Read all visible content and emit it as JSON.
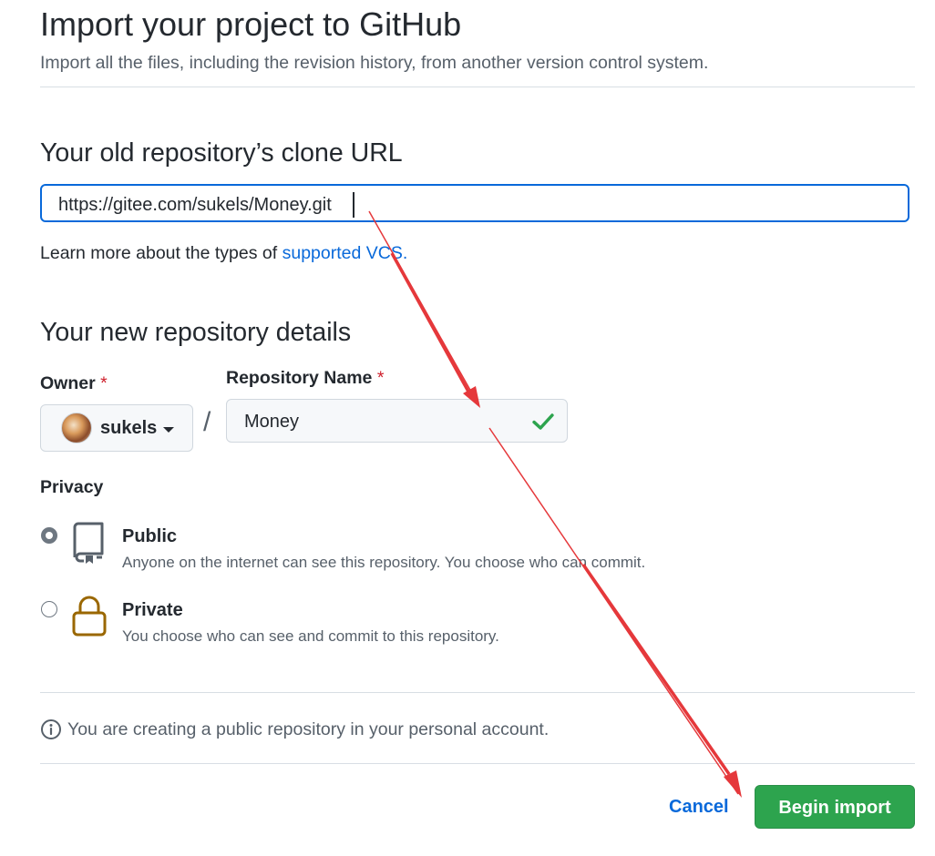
{
  "header": {
    "title": "Import your project to GitHub",
    "subtitle": "Import all the files, including the revision history, from another version control system."
  },
  "clone_section": {
    "heading": "Your old repository’s clone URL",
    "url_value": "https://gitee.com/sukels/Money.git",
    "help_prefix": "Learn more about the types of ",
    "help_link": "supported VCS",
    "help_suffix": "."
  },
  "details_section": {
    "heading": "Your new repository details",
    "owner_label": "Owner",
    "required_mark": "*",
    "owner_value": "sukels",
    "separator": "/",
    "repo_name_label": "Repository Name",
    "repo_name_value": "Money"
  },
  "privacy": {
    "label": "Privacy",
    "options": [
      {
        "title": "Public",
        "description": "Anyone on the internet can see this repository. You choose who can commit.",
        "selected": true
      },
      {
        "title": "Private",
        "description": "You choose who can see and commit to this repository.",
        "selected": false
      }
    ]
  },
  "notice": {
    "text": "You are creating a public repository in your personal account."
  },
  "actions": {
    "cancel_label": "Cancel",
    "begin_label": "Begin import"
  },
  "colors": {
    "accent": "#0969da",
    "primary_button": "#2da44e",
    "check": "#2da44e",
    "private_icon": "#9a6700",
    "annotation_arrow": "#e5383b"
  },
  "icons": {
    "info": "info-icon",
    "check": "check-icon",
    "public": "repo-book-icon",
    "private": "lock-icon"
  }
}
